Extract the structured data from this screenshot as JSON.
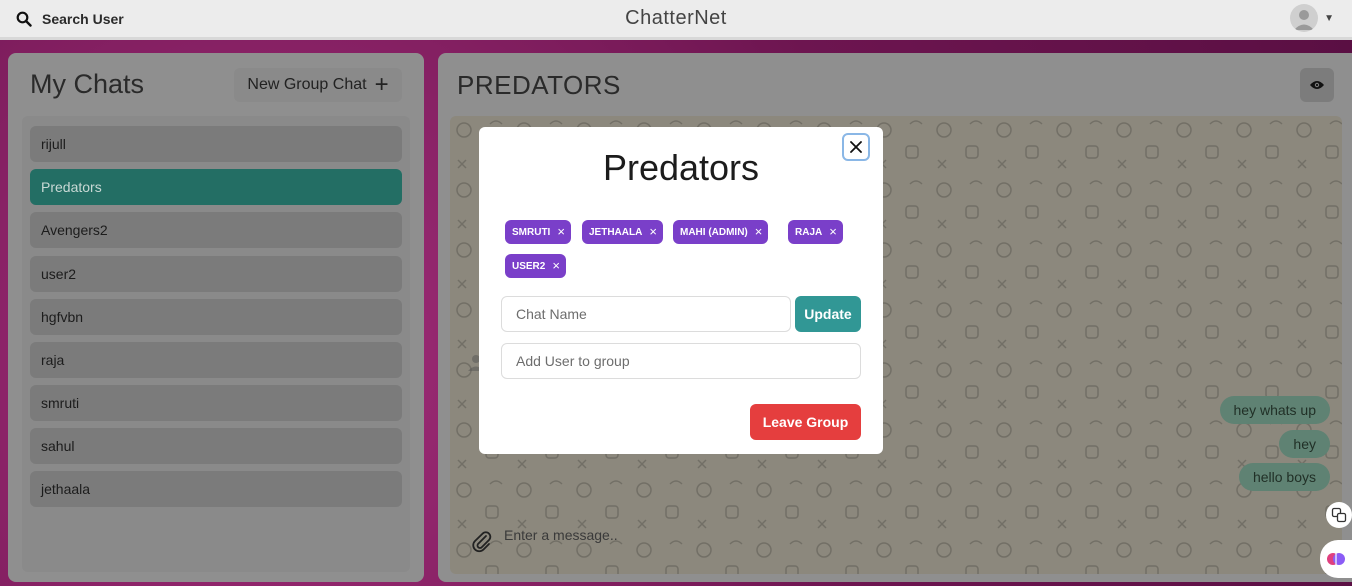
{
  "header": {
    "search_label": "Search User",
    "app_title": "ChatterNet",
    "profile_icon": "avatar-icon"
  },
  "sidebar": {
    "title": "My Chats",
    "new_group_label": "New Group Chat",
    "chats": [
      {
        "name": "rijull",
        "active": false
      },
      {
        "name": "Predators",
        "active": true
      },
      {
        "name": "Avengers2",
        "active": false
      },
      {
        "name": "user2",
        "active": false
      },
      {
        "name": "hgfvbn",
        "active": false
      },
      {
        "name": "raja",
        "active": false
      },
      {
        "name": "smruti",
        "active": false
      },
      {
        "name": "sahul",
        "active": false
      },
      {
        "name": "jethaala",
        "active": false
      }
    ]
  },
  "chat": {
    "title": "PREDATORS",
    "messages": [
      {
        "text": "hey whats up"
      },
      {
        "text": "hey"
      },
      {
        "text": "hello boys"
      }
    ],
    "input_placeholder": "Enter a message.."
  },
  "modal": {
    "title": "Predators",
    "members": [
      {
        "label": "SMRUTI"
      },
      {
        "label": "JETHAALA"
      },
      {
        "label": "MAHI (ADMIN)"
      },
      {
        "label": "RAJA"
      },
      {
        "label": "USER2"
      }
    ],
    "chat_name_placeholder": "Chat Name",
    "update_label": "Update",
    "add_user_placeholder": "Add User to group",
    "leave_label": "Leave Group"
  },
  "colors": {
    "active_chat": "#236e64",
    "tag": "#7a3fc9",
    "update": "#319795",
    "leave": "#e53e3e"
  }
}
